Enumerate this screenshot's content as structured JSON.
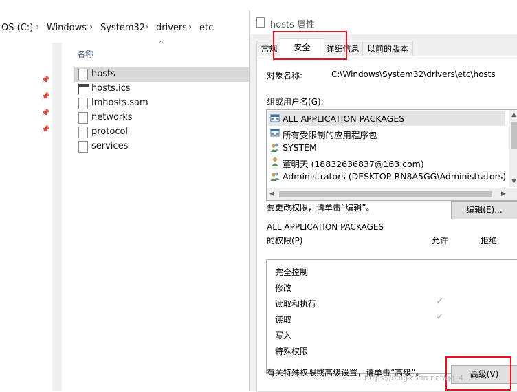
{
  "explorer": {
    "breadcrumb": [
      "OS (C:)",
      "Windows",
      "System32",
      "drivers",
      "etc"
    ],
    "column_header": "名称",
    "files": [
      {
        "name": "hosts",
        "icon": "file-icon",
        "selected": true
      },
      {
        "name": "hosts.ics",
        "icon": "calendar-file-icon",
        "selected": false
      },
      {
        "name": "lmhosts.sam",
        "icon": "file-icon",
        "selected": false
      },
      {
        "name": "networks",
        "icon": "file-icon",
        "selected": false
      },
      {
        "name": "protocol",
        "icon": "file-icon",
        "selected": false
      },
      {
        "name": "services",
        "icon": "file-icon",
        "selected": false
      }
    ]
  },
  "dialog": {
    "title": "hosts 属性",
    "tabs": [
      "常规",
      "安全",
      "详细信息",
      "以前的版本"
    ],
    "active_tab": "安全",
    "object_label": "对象名称:",
    "object_value": "C:\\Windows\\System32\\drivers\\etc\\hosts",
    "groups_label": "组或用户名(G):",
    "groups": [
      {
        "name": "ALL APPLICATION PACKAGES",
        "icon": "app-package-icon"
      },
      {
        "name": "所有受限制的应用程序包",
        "icon": "app-package-icon"
      },
      {
        "name": "SYSTEM",
        "icon": "user-group-icon"
      },
      {
        "name": "董明天 (18832636837@163.com)",
        "icon": "user-icon"
      },
      {
        "name": "Administrators (DESKTOP-RN8A5GG\\Administrators)",
        "icon": "user-group-icon"
      }
    ],
    "edit_hint": "要更改权限，请单击“编辑”。",
    "edit_button": "编辑(E)...",
    "perm_for": "ALL APPLICATION PACKAGES",
    "perm_label": "的权限(P)",
    "allow_header": "允许",
    "deny_header": "拒绝",
    "permissions": [
      {
        "name": "完全控制",
        "allow": false
      },
      {
        "name": "修改",
        "allow": false
      },
      {
        "name": "读取和执行",
        "allow": true
      },
      {
        "name": "读取",
        "allow": true
      },
      {
        "name": "写入",
        "allow": false
      },
      {
        "name": "特殊权限",
        "allow": false
      }
    ],
    "advanced_hint": "有关特殊权限或高级设置，请单击“高级”。",
    "advanced_button": "高级(V)",
    "check_glyph": "✓"
  },
  "watermark": "https://blog.csdn.net/qq_4...",
  "colors": {
    "highlight": "#e81123",
    "selection": "#d9d9d9"
  }
}
